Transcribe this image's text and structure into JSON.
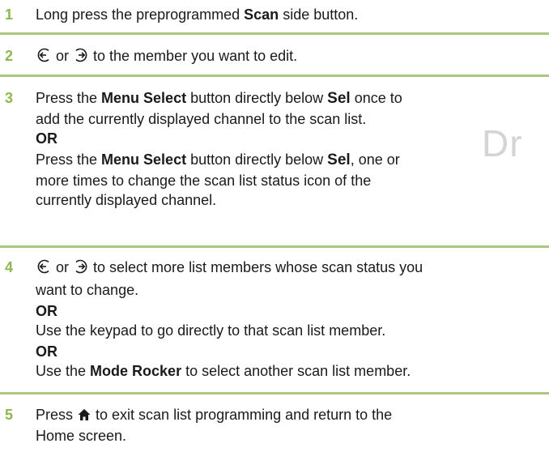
{
  "watermark": "Dr",
  "steps": [
    {
      "num": "1",
      "pre": "Long press the preprogrammed ",
      "bold": "Scan",
      "post": " side button."
    },
    {
      "num": "2",
      "or": " or ",
      "text": " to the member you want to edit."
    },
    {
      "num": "3",
      "a_pre": "Press the ",
      "a_bold": "Menu Select",
      "a_mid": " button directly below ",
      "a_sel": "Sel",
      "a_post": " once to",
      "a_line2": "add the currently displayed channel to the scan list.",
      "or": "OR",
      "b_pre": "Press the ",
      "b_bold": "Menu Select",
      "b_mid": " button directly below ",
      "b_sel": "Sel",
      "b_post": ", one or",
      "b_line2": "more times to change the scan list status icon of the",
      "b_line3": "currently displayed channel."
    },
    {
      "num": "4",
      "or_word": " or ",
      "line1": " to select more list members whose scan status you",
      "line2": "want to change.",
      "or1": "OR",
      "line3": "Use the keypad to go directly to that scan list member.",
      "or2": "OR",
      "l5_pre": "Use the ",
      "l5_bold": "Mode Rocker",
      "l5_post": " to select another scan list member."
    },
    {
      "num": "5",
      "pre": "Press ",
      "post": " to exit scan list programming and return to the",
      "line2": "Home screen."
    }
  ],
  "colors": {
    "accent": "#8cb84f",
    "rule": "#a8c97f",
    "text": "#1a1a1a"
  },
  "icons": [
    "left-arrow-circle-icon",
    "right-arrow-circle-icon",
    "home-icon"
  ]
}
